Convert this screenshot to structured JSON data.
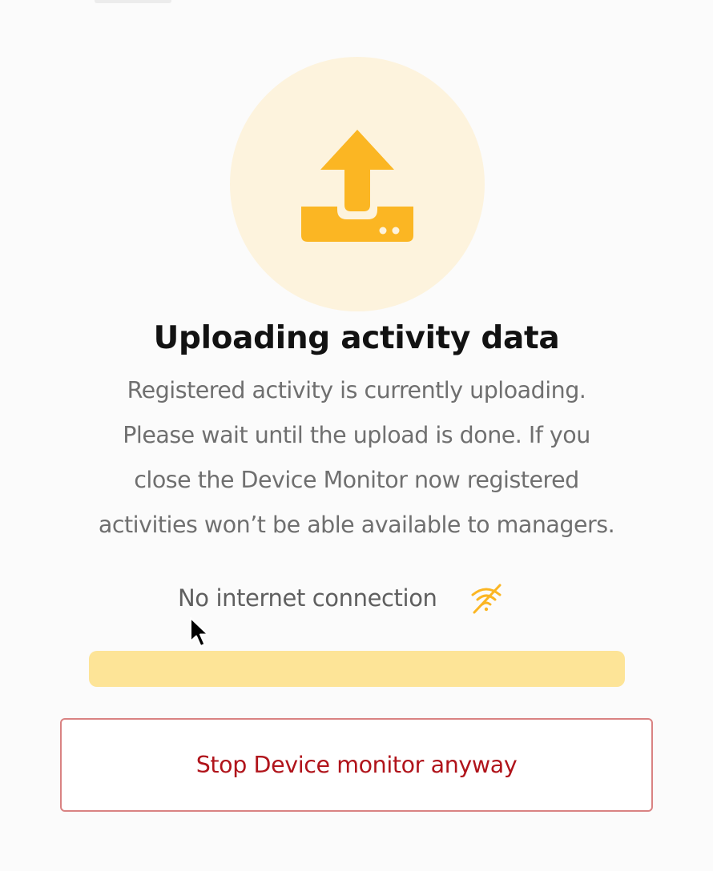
{
  "dialog": {
    "title": "Uploading activity data",
    "message_lines": [
      "Registered activity is currently uploading.",
      "Please wait until the upload is done. If you",
      "close the Device Monitor now registered",
      "activities won’t be able available to managers."
    ],
    "icon": "upload-icon",
    "status": {
      "text": "No internet connection",
      "icon": "wifi-off-icon"
    },
    "progress": {
      "percent": 0
    },
    "stop_button": {
      "label": "Stop Device monitor anyway"
    }
  },
  "colors": {
    "accent": "#fbb623",
    "icon_circle": "#fdf3dd",
    "progress_track": "#fde497",
    "danger_text": "#b0141b",
    "danger_border": "#d98282"
  }
}
